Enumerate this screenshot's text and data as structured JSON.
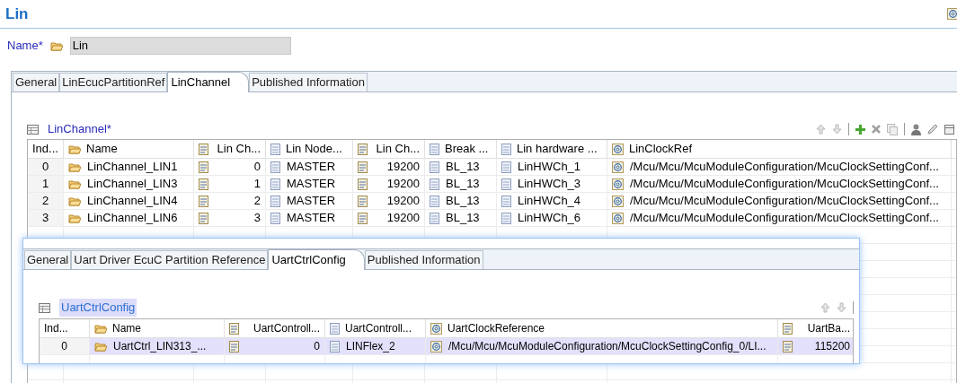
{
  "header": {
    "title": "Lin"
  },
  "name_field": {
    "label": "Name*",
    "value": "Lin"
  },
  "tabs": [
    {
      "label": "General",
      "selected": false
    },
    {
      "label": "LinEcucPartitionRef",
      "selected": false
    },
    {
      "label": "LinChannel",
      "selected": true
    },
    {
      "label": "Published Information",
      "selected": false
    }
  ],
  "table": {
    "title": "LinChannel*",
    "columns": [
      {
        "label": "Ind...",
        "kind": "index"
      },
      {
        "label": "Name",
        "kind": "folder"
      },
      {
        "label": "Lin Ch...",
        "kind": "number"
      },
      {
        "label": "Lin Node...",
        "kind": "text"
      },
      {
        "label": "Lin Ch...",
        "kind": "number"
      },
      {
        "label": "Break ...",
        "kind": "text"
      },
      {
        "label": "Lin hardware ...",
        "kind": "text"
      },
      {
        "label": "LinClockRef",
        "kind": "ref"
      }
    ],
    "rows": [
      {
        "selected": false,
        "cells": [
          "0",
          "LinChannel_LIN1",
          "0",
          "MASTER",
          "19200",
          "BL_13",
          "LinHWCh_1",
          "/Mcu/Mcu/McuModuleConfiguration/McuClockSettingConf..."
        ]
      },
      {
        "selected": false,
        "cells": [
          "1",
          "LinChannel_LIN3",
          "1",
          "MASTER",
          "19200",
          "BL_13",
          "LinHWCh_3",
          "/Mcu/Mcu/McuModuleConfiguration/McuClockSettingConf..."
        ]
      },
      {
        "selected": false,
        "cells": [
          "2",
          "LinChannel_LIN4",
          "2",
          "MASTER",
          "19200",
          "BL_13",
          "LinHWCh_4",
          "/Mcu/Mcu/McuModuleConfiguration/McuClockSettingConf..."
        ]
      },
      {
        "selected": false,
        "cells": [
          "3",
          "LinChannel_LIN6",
          "3",
          "MASTER",
          "19200",
          "BL_13",
          "LinHWCh_6",
          "/Mcu/Mcu/McuModuleConfiguration/McuClockSettingConf..."
        ]
      }
    ]
  },
  "popup": {
    "tabs": [
      {
        "label": "General",
        "selected": false
      },
      {
        "label": "Uart Driver EcuC Partition Reference",
        "selected": false
      },
      {
        "label": "UartCtrlConfig",
        "selected": true
      },
      {
        "label": "Published Information",
        "selected": false
      }
    ],
    "table": {
      "title": "UartCtrlConfig",
      "columns": [
        {
          "label": "Ind...",
          "kind": "index"
        },
        {
          "label": "Name",
          "kind": "folder"
        },
        {
          "label": "UartControll...",
          "kind": "number"
        },
        {
          "label": "UartControll...",
          "kind": "text"
        },
        {
          "label": "UartClockReference",
          "kind": "ref"
        },
        {
          "label": "UartBa...",
          "kind": "number"
        }
      ],
      "rows": [
        {
          "selected": true,
          "cells": [
            "0",
            "UartCtrl_LIN313_...",
            "0",
            "LINFlex_2",
            "/Mcu/Mcu/McuModuleConfiguration/McuClockSettingConfig_0/LI...",
            "115200"
          ]
        }
      ]
    }
  }
}
